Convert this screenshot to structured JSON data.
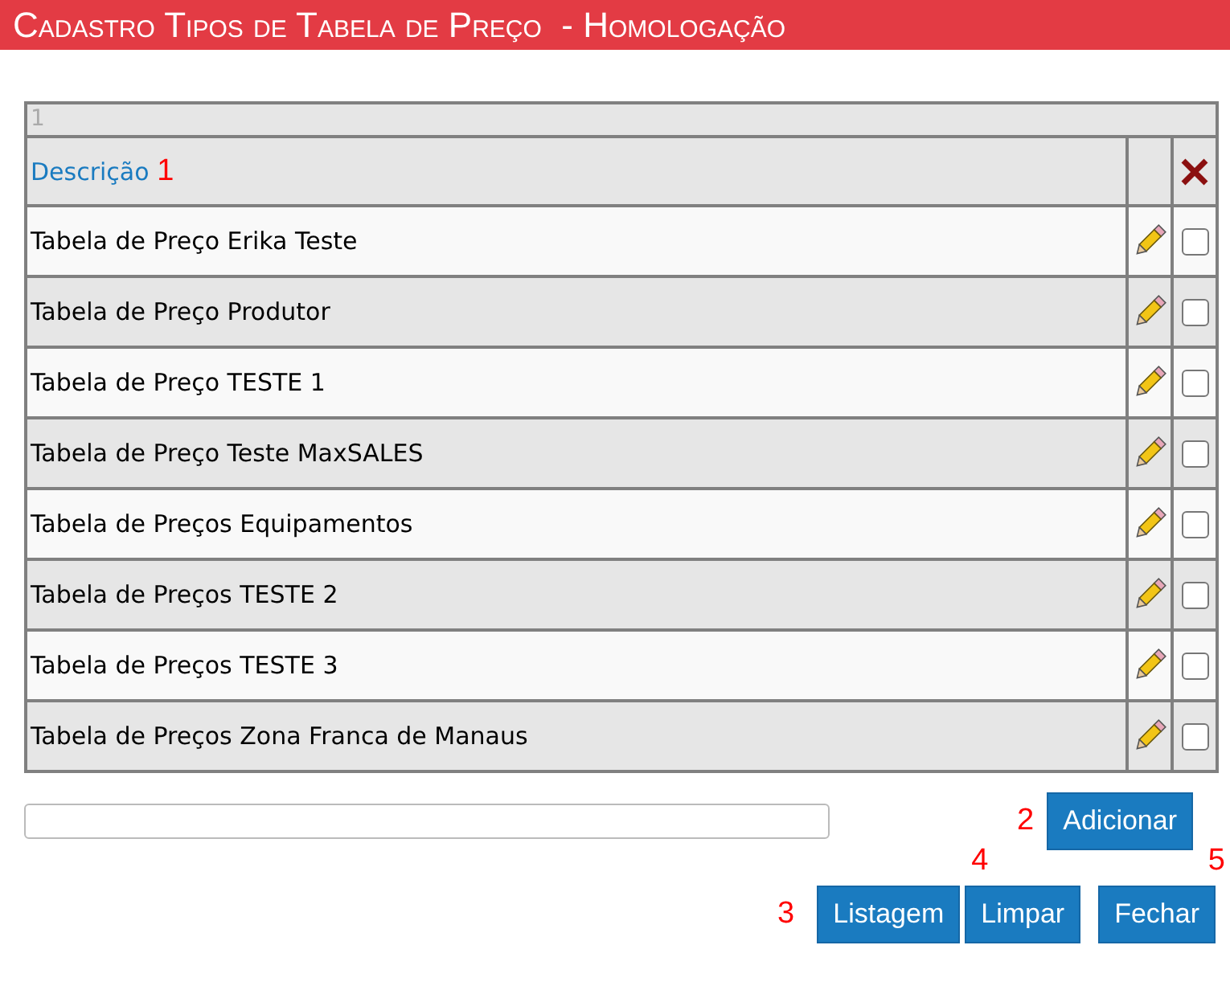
{
  "window": {
    "title": "Cadastro Tipos de Tabela de Preço  - Homologação"
  },
  "table": {
    "page": "1",
    "column_header": "Descrição",
    "rows": [
      {
        "description": "Tabela de Preço Erika Teste",
        "checked": false
      },
      {
        "description": "Tabela de Preço Produtor",
        "checked": false
      },
      {
        "description": "Tabela de Preço TESTE 1",
        "checked": false
      },
      {
        "description": "Tabela de Preço Teste MaxSALES",
        "checked": false
      },
      {
        "description": "Tabela de Preços Equipamentos",
        "checked": false
      },
      {
        "description": "Tabela de Preços TESTE 2",
        "checked": false
      },
      {
        "description": "Tabela de Preços TESTE 3",
        "checked": false
      },
      {
        "description": "Tabela de Preços Zona Franca de Manaus",
        "checked": false
      }
    ]
  },
  "buttons": {
    "add": "Adicionar",
    "list": "Listagem",
    "clear": "Limpar",
    "close": "Fechar"
  },
  "annotations": [
    "1",
    "2",
    "3",
    "4",
    "5"
  ]
}
